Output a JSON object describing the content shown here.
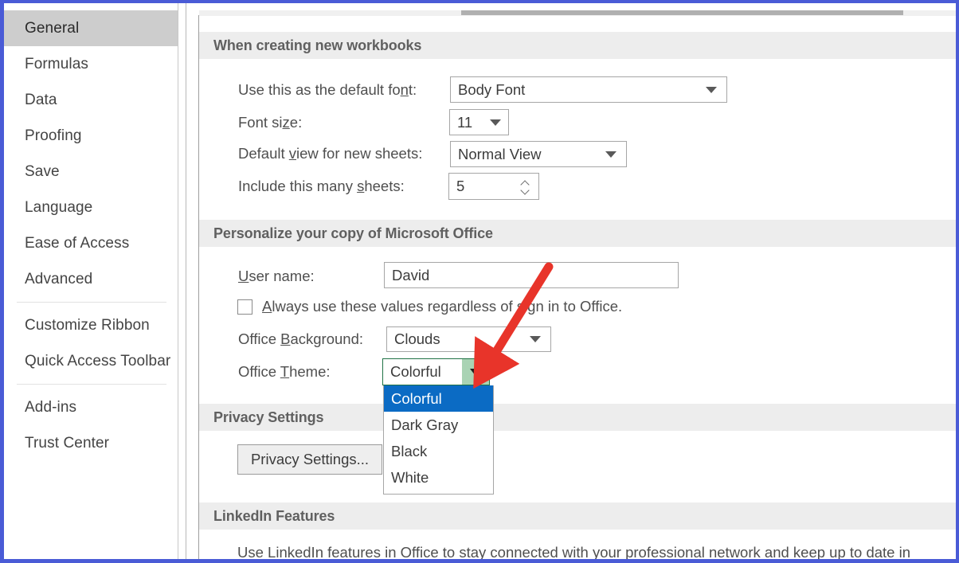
{
  "window": {
    "accent_border_color": "#4a5bd6",
    "panel_background": "#ffffff"
  },
  "sidebar": {
    "items": [
      {
        "label": "General",
        "selected": true
      },
      {
        "label": "Formulas",
        "selected": false
      },
      {
        "label": "Data",
        "selected": false
      },
      {
        "label": "Proofing",
        "selected": false
      },
      {
        "label": "Save",
        "selected": false
      },
      {
        "label": "Language",
        "selected": false
      },
      {
        "label": "Ease of Access",
        "selected": false
      },
      {
        "label": "Advanced",
        "selected": false
      },
      {
        "label": "Customize Ribbon",
        "selected": false
      },
      {
        "label": "Quick Access Toolbar",
        "selected": false
      },
      {
        "label": "Add-ins",
        "selected": false
      },
      {
        "label": "Trust Center",
        "selected": false
      }
    ]
  },
  "sections": {
    "workbooks": {
      "header": "When creating new workbooks",
      "default_font": {
        "label_pre": "Use this as the default fo",
        "label_accel": "n",
        "label_post": "t:",
        "value": "Body Font"
      },
      "font_size": {
        "label_pre": "Font si",
        "label_accel": "z",
        "label_post": "e:",
        "value": "11"
      },
      "default_view": {
        "label_pre": "Default ",
        "label_accel": "v",
        "label_post": "iew for new sheets:",
        "value": "Normal View"
      },
      "sheet_count": {
        "label_pre": "Include this many ",
        "label_accel": "s",
        "label_post": "heets:",
        "value": "5"
      }
    },
    "personalize": {
      "header": "Personalize your copy of Microsoft Office",
      "user_name": {
        "label_accel": "U",
        "label_post": "ser name:",
        "value": "David",
        "placeholder": ""
      },
      "always_use": {
        "label_accel": "A",
        "label_post": "lways use these values regardless of sign in to Office.",
        "checked": false
      },
      "office_background": {
        "label_pre": "Office ",
        "label_accel": "B",
        "label_post": "ackground:",
        "value": "Clouds"
      },
      "office_theme": {
        "label_pre": "Office ",
        "label_accel": "T",
        "label_post": "heme:",
        "value": "Colorful",
        "open": true,
        "focus_color": "#217346",
        "dropdown_button_color": "#a9d3b4",
        "options": [
          {
            "label": "Colorful",
            "selected": true
          },
          {
            "label": "Dark Gray",
            "selected": false
          },
          {
            "label": "Black",
            "selected": false
          },
          {
            "label": "White",
            "selected": false
          }
        ],
        "highlight_color": "#0b6bc4"
      }
    },
    "privacy": {
      "header": "Privacy Settings",
      "button_label": "Privacy Settings..."
    },
    "linkedin": {
      "header": "LinkedIn Features",
      "description": "Use LinkedIn features in Office to stay connected with your professional network and keep up to date in"
    }
  },
  "annotation": {
    "arrow_color": "#e8342a",
    "points_to": "office-theme-dropdown-button"
  }
}
